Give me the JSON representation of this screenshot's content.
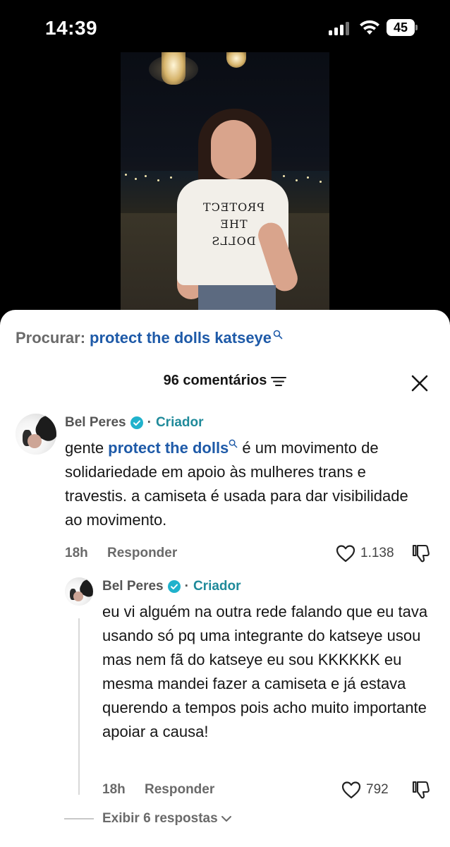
{
  "status_bar": {
    "time": "14:39",
    "battery": "45"
  },
  "search": {
    "label": "Procurar:",
    "query": "protect the dolls katseye"
  },
  "comments_header": {
    "count_label": "96 comentários"
  },
  "video": {
    "shirt_text": [
      "PROTECT",
      "THE",
      "DOLLS"
    ]
  },
  "comments": [
    {
      "author": "Bel Peres",
      "separator": "·",
      "badge": "Criador",
      "text_link": "protect the dolls",
      "text_prefix": "gente ",
      "text_rest": " é um movimento de solidariedade em apoio às mulheres trans e travestis. a camiseta é usada para dar visibilidade ao movimento.",
      "time": "18h",
      "reply_label": "Responder",
      "likes": "1.138"
    },
    {
      "author": "Bel Peres",
      "separator": "·",
      "badge": "Criador",
      "text": "eu vi alguém na outra rede falando que eu tava usando só pq uma integrante do katseye usou mas nem fã do katseye eu sou KKKKKK eu mesma mandei fazer a camiseta e já estava querendo a tempos pois acho muito importante apoiar a causa!",
      "time": "18h",
      "reply_label": "Responder",
      "likes": "792"
    }
  ],
  "view_replies": {
    "label": "Exibir 6 respostas"
  },
  "colors": {
    "link": "#1e5aa8",
    "creator": "#1f8a9a",
    "verified": "#20b2cc",
    "muted": "#6a6a6a"
  }
}
